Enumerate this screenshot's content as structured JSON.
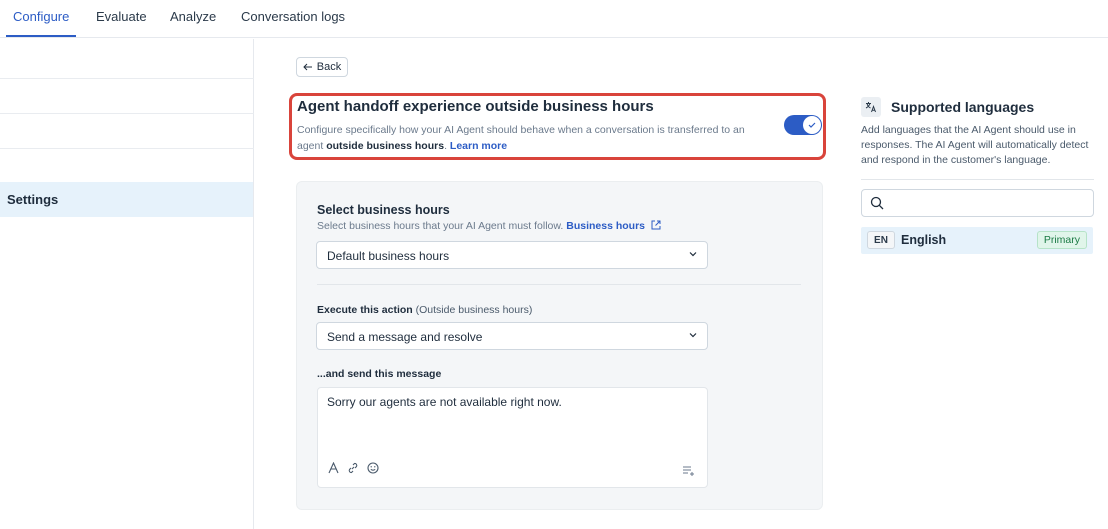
{
  "nav": {
    "tabs": [
      {
        "label": "Configure",
        "active": true
      },
      {
        "label": "Evaluate"
      },
      {
        "label": "Analyze"
      },
      {
        "label": "Conversation logs"
      }
    ]
  },
  "sidebar": {
    "active_item": "Settings"
  },
  "back": {
    "label": "Back",
    "icon": "arrow-left-icon"
  },
  "header": {
    "title": "Agent handoff experience outside business hours",
    "desc_part1": "Configure specifically how your AI Agent should behave when a conversation is transferred to an agent ",
    "desc_bold": "outside business hours",
    "desc_part2": ". ",
    "learn_more": "Learn more",
    "toggle_on": true
  },
  "business_hours": {
    "label": "Select business hours",
    "sublabel": "Select business hours that your AI Agent must follow.",
    "link": "Business hours",
    "selected": "Default business hours"
  },
  "action": {
    "label": "Execute this action",
    "label_suffix": "(Outside business hours)",
    "selected": "Send a message and resolve"
  },
  "message": {
    "label": "...and send this message",
    "text": "Sorry our agents are not available right now.",
    "toolbar": [
      "text-format-icon",
      "link-icon",
      "emoji-icon",
      "insert-placeholder-icon"
    ]
  },
  "languages": {
    "title": "Supported languages",
    "description": "Add languages that the AI Agent should use in responses. The AI Agent will automatically detect and respond in the customer's language.",
    "search_placeholder": "",
    "items": [
      {
        "code": "EN",
        "name": "English",
        "badge": "Primary"
      }
    ]
  },
  "colors": {
    "accent": "#2c5cc5",
    "highlight_border": "#d9443b",
    "primary_badge_bg": "#e0f5ea",
    "selected_row_bg": "#e6f2fb"
  }
}
